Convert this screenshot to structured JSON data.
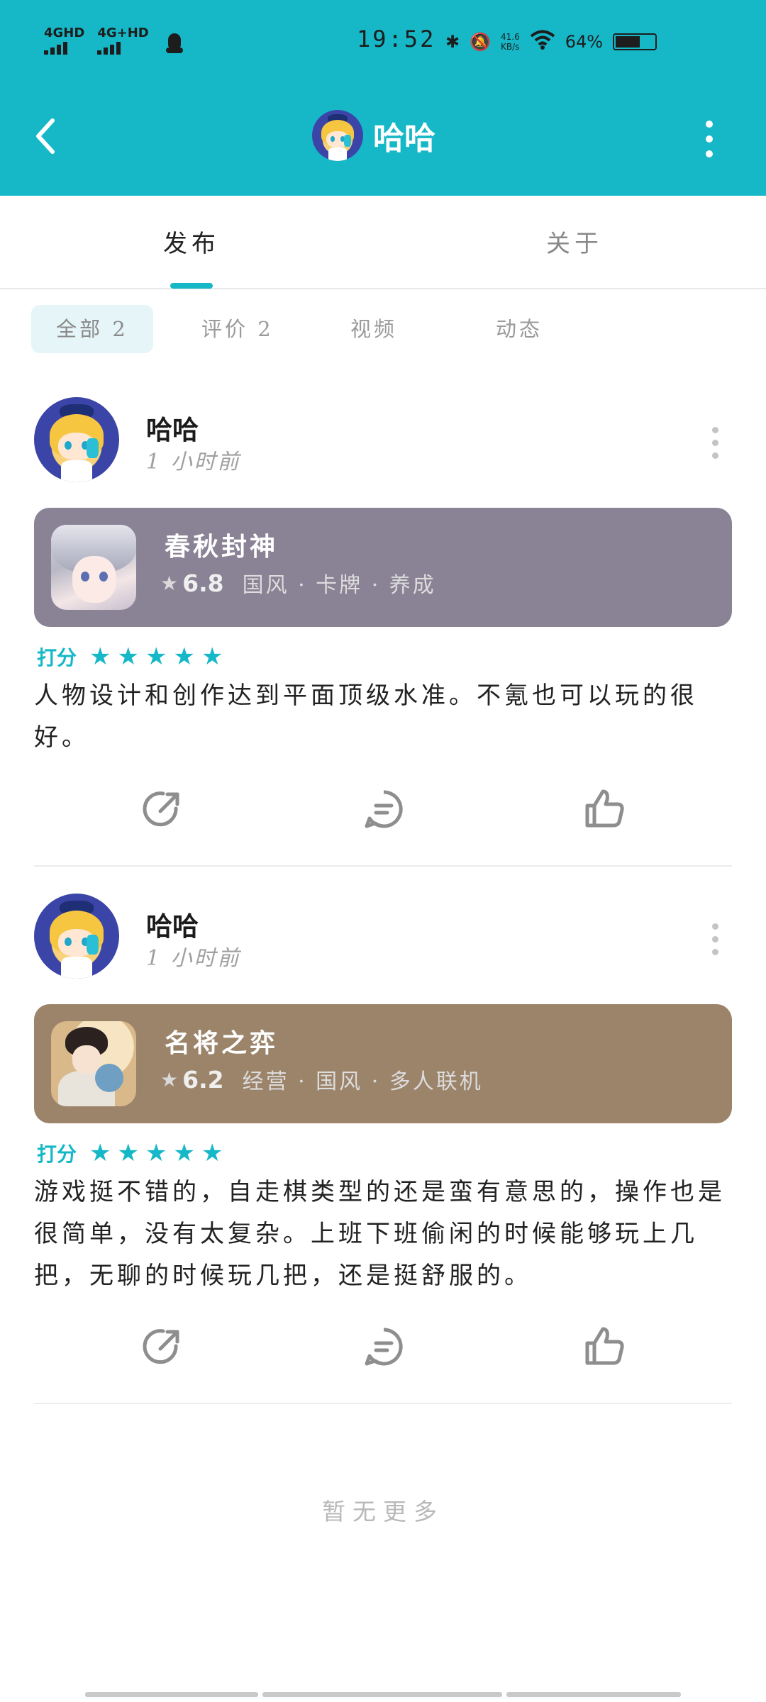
{
  "status_bar": {
    "signal1": "4GHD",
    "signal2": "4G+HD",
    "time": "19:52",
    "speed_value": "41.6",
    "speed_unit": "KB/s",
    "battery": "64%"
  },
  "header": {
    "title": "哈哈"
  },
  "tabs": {
    "publish": "发布",
    "about": "关于"
  },
  "subtabs": {
    "all": "全部 2",
    "reviews": "评价 2",
    "videos": "视频",
    "feed": "动态"
  },
  "posts": [
    {
      "user": "哈哈",
      "time": "1 小时前",
      "game": {
        "name": "春秋封神",
        "score": "6.8",
        "tags": "国风 · 卡牌 · 养成"
      },
      "rating_label": "打分",
      "rating": 5,
      "text": "人物设计和创作达到平面顶级水准。不氪也可以玩的很好。"
    },
    {
      "user": "哈哈",
      "time": "1 小时前",
      "game": {
        "name": "名将之弈",
        "score": "6.2",
        "tags": "经营 · 国风 · 多人联机"
      },
      "rating_label": "打分",
      "rating": 5,
      "text": "游戏挺不错的，自走棋类型的还是蛮有意思的，操作也是很简单，没有太复杂。上班下班偷闲的时候能够玩上几把，无聊的时候玩几把，还是挺舒服的。"
    }
  ],
  "footer": {
    "no_more": "暂无更多"
  },
  "colors": {
    "accent": "#16b8c7",
    "card1": "#8a8295",
    "card2": "#9c846a"
  },
  "icons": [
    "back-arrow-icon",
    "more-vertical-icon",
    "share-icon",
    "comment-icon",
    "like-icon",
    "star-icon"
  ]
}
